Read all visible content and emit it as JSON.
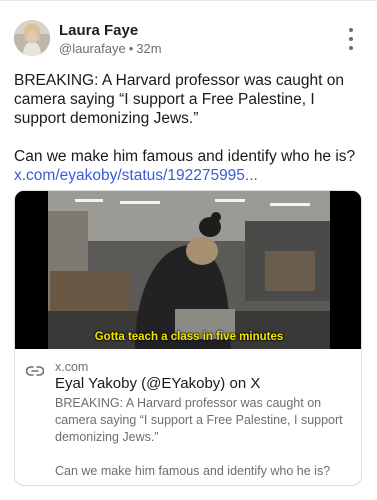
{
  "post": {
    "author_name": "Laura Faye",
    "handle": "@laurafaye",
    "separator": "•",
    "time": "32m",
    "body_line1": "BREAKING: A Harvard professor was caught on camera saying “I support a Free Palestine, I support demonizing Jews.”",
    "body_line2": "Can we make him famous and identify who he is?",
    "link_text": "x.com/eyakoby/status/192275995..."
  },
  "embed": {
    "video_caption": "Gotta teach a class in five minutes",
    "domain": "x.com",
    "title": "Eyal Yakoby (@EYakoby) on X",
    "desc_line1": "BREAKING: A Harvard professor was caught on camera saying “I support a Free Palestine, I support demonizing Jews.”",
    "desc_line2": "Can we make him famous and identify who he is?"
  },
  "icons": {
    "more": "more-vertical-icon",
    "link": "link-icon"
  },
  "colors": {
    "link": "#3b5bd6",
    "caption": "#f2e600",
    "muted_text": "#6e6e6e"
  }
}
